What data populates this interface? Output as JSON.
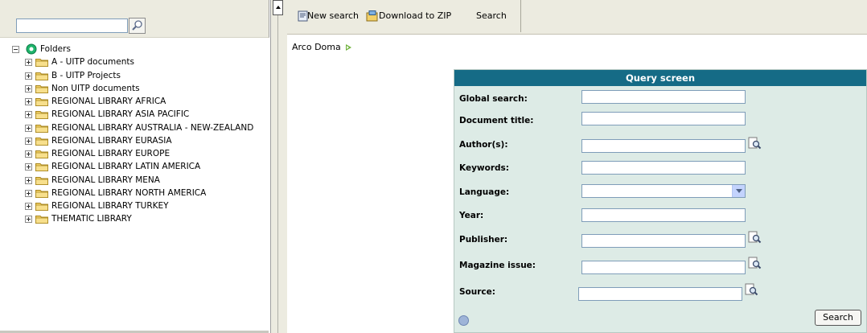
{
  "left": {
    "search": {
      "value": ""
    },
    "tree": {
      "root_label": "Folders",
      "items": [
        {
          "label": "A - UITP documents"
        },
        {
          "label": "B - UITP Projects"
        },
        {
          "label": "Non UITP documents"
        },
        {
          "label": "REGIONAL LIBRARY AFRICA"
        },
        {
          "label": "REGIONAL LIBRARY ASIA PACIFIC"
        },
        {
          "label": "REGIONAL LIBRARY AUSTRALIA - NEW-ZEALAND"
        },
        {
          "label": "REGIONAL LIBRARY EURASIA"
        },
        {
          "label": "REGIONAL LIBRARY EUROPE"
        },
        {
          "label": "REGIONAL LIBRARY LATIN AMERICA"
        },
        {
          "label": "REGIONAL LIBRARY MENA"
        },
        {
          "label": "REGIONAL LIBRARY NORTH AMERICA"
        },
        {
          "label": "REGIONAL LIBRARY TURKEY"
        },
        {
          "label": "THEMATIC LIBRARY"
        }
      ]
    }
  },
  "toolbar": {
    "new_search": "New search",
    "download_zip": "Download to ZIP",
    "search": "Search"
  },
  "breadcrumb": {
    "label": "Arco Doma"
  },
  "query": {
    "title": "Query screen",
    "fields": {
      "global_search": {
        "label": "Global search:",
        "value": ""
      },
      "document_title": {
        "label": "Document title:",
        "value": ""
      },
      "authors": {
        "label": "Author(s):",
        "value": ""
      },
      "keywords": {
        "label": "Keywords:",
        "value": ""
      },
      "language": {
        "label": "Language:",
        "value": ""
      },
      "year": {
        "label": "Year:",
        "value": ""
      },
      "publisher": {
        "label": "Publisher:",
        "value": ""
      },
      "magazine_issue": {
        "label": "Magazine issue:",
        "value": ""
      },
      "source": {
        "label": "Source:",
        "value": ""
      }
    },
    "search_button": "Search"
  },
  "colors": {
    "panel_header": "#156b86",
    "panel_background": "#ddebe6",
    "toolbar_background": "#ecebe0",
    "folder_yellow": "#f2d068"
  },
  "icons": [
    "search-icon",
    "folders-root-icon",
    "folder-icon",
    "new-search-icon",
    "download-zip-icon",
    "lookup-icon",
    "help-icon",
    "dropdown-arrow-icon",
    "collapse-arrow-icon"
  ]
}
